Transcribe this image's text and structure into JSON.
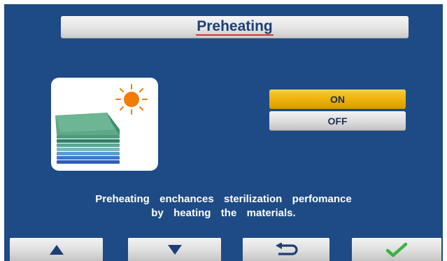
{
  "header": {
    "title": "Preheating"
  },
  "illustration": {
    "icons": [
      "sun-icon",
      "stacked-textiles-icon"
    ]
  },
  "options": {
    "on_label": "ON",
    "off_label": "OFF",
    "selected": "ON"
  },
  "description": {
    "line1": "Preheating  enchances  sterilization  perfomance",
    "line2": "by  heating  the  materials."
  },
  "footer": {
    "buttons": [
      "up-arrow-icon",
      "down-arrow-icon",
      "return-icon",
      "checkmark-icon"
    ]
  },
  "colors": {
    "background": "#1e4b85",
    "selected_option": "#f0b310",
    "unselected_option": "#d8d8d8",
    "title_text": "#1c3f76",
    "sun": "#f07d0a",
    "confirm": "#3cb043"
  }
}
